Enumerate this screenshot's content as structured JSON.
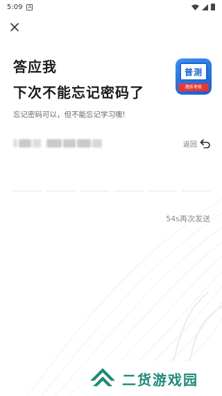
{
  "status_bar": {
    "time": "5:09",
    "notification_icon": "A"
  },
  "header": {
    "close_icon": "close-icon"
  },
  "title_line1": "答应我",
  "title_line2": "下次不能忘记密码了",
  "app_logo": {
    "main_text": "普测",
    "banner_text": "题库考练"
  },
  "subtitle": "忘记密码可以，但不能忘记学习噢!",
  "phone": {
    "masked_value": ""
  },
  "back": {
    "label": "返回"
  },
  "code_inputs": {
    "count": 6
  },
  "resend": {
    "label": "54s再次发送"
  },
  "watermark": {
    "text": "二货游戏园"
  },
  "colors": {
    "accent_blue": "#1e66d0",
    "logo_red": "#e53935",
    "watermark_green": "#1d8a7a"
  }
}
